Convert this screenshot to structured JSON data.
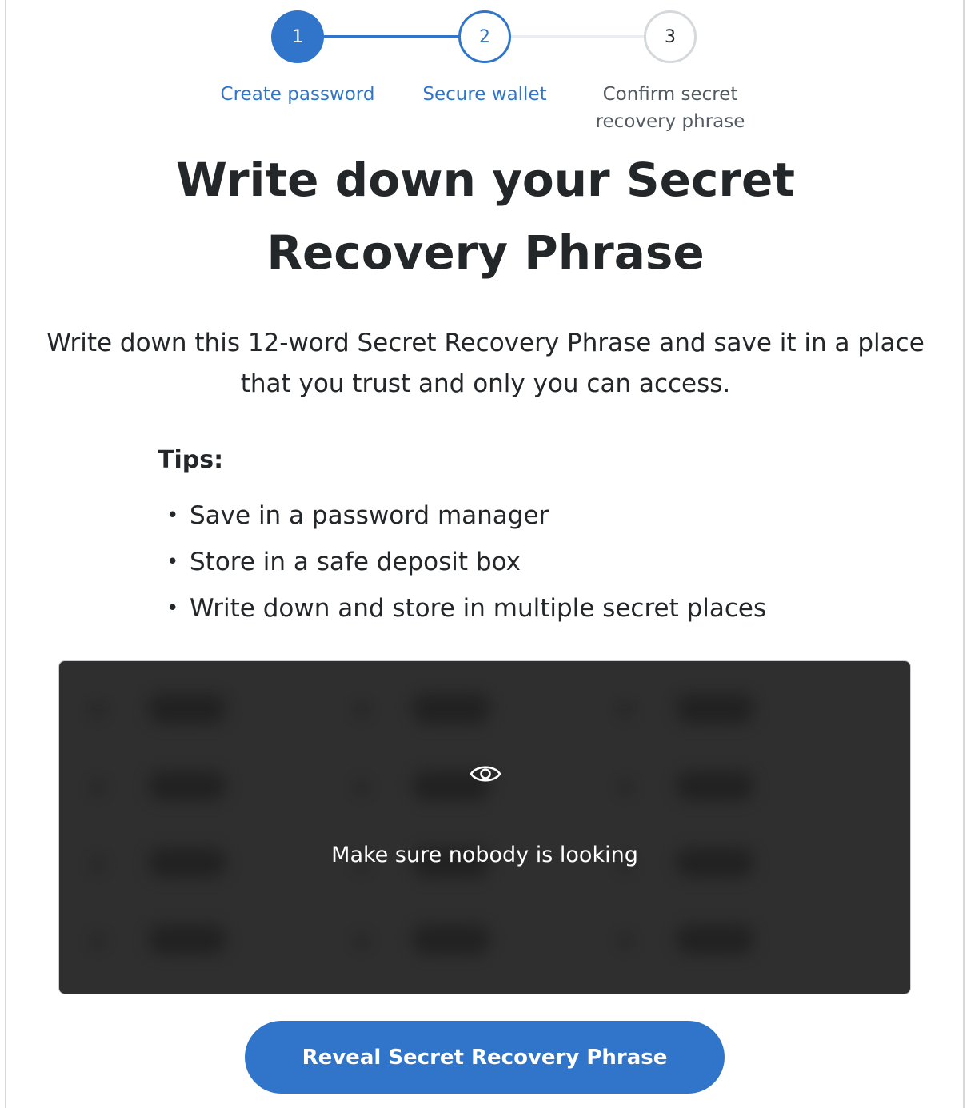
{
  "stepper": {
    "steps": [
      {
        "number": "1",
        "label": "Create password",
        "state": "complete"
      },
      {
        "number": "2",
        "label": "Secure wallet",
        "state": "active"
      },
      {
        "number": "3",
        "label_line1": "Confirm secret",
        "label_line2": "recovery phrase",
        "state": "pending"
      }
    ]
  },
  "heading": {
    "line1": "Write down your Secret",
    "line2": "Recovery Phrase"
  },
  "description": "Write down this 12-word Secret Recovery Phrase and save it in a place that you trust and only you can access.",
  "tips": {
    "heading": "Tips:",
    "items": [
      "Save in a password manager",
      "Store in a safe deposit box",
      "Write down and store in multiple secret places"
    ]
  },
  "secret_box": {
    "icon": "eye-icon",
    "message": "Make sure nobody is looking"
  },
  "reveal_button": {
    "label": "Reveal Secret Recovery Phrase"
  },
  "colors": {
    "primary": "#3075c9",
    "box_background": "#2f2f2f",
    "text": "#24272a",
    "muted": "#535a61",
    "inactive_border": "#d6d9dc"
  }
}
